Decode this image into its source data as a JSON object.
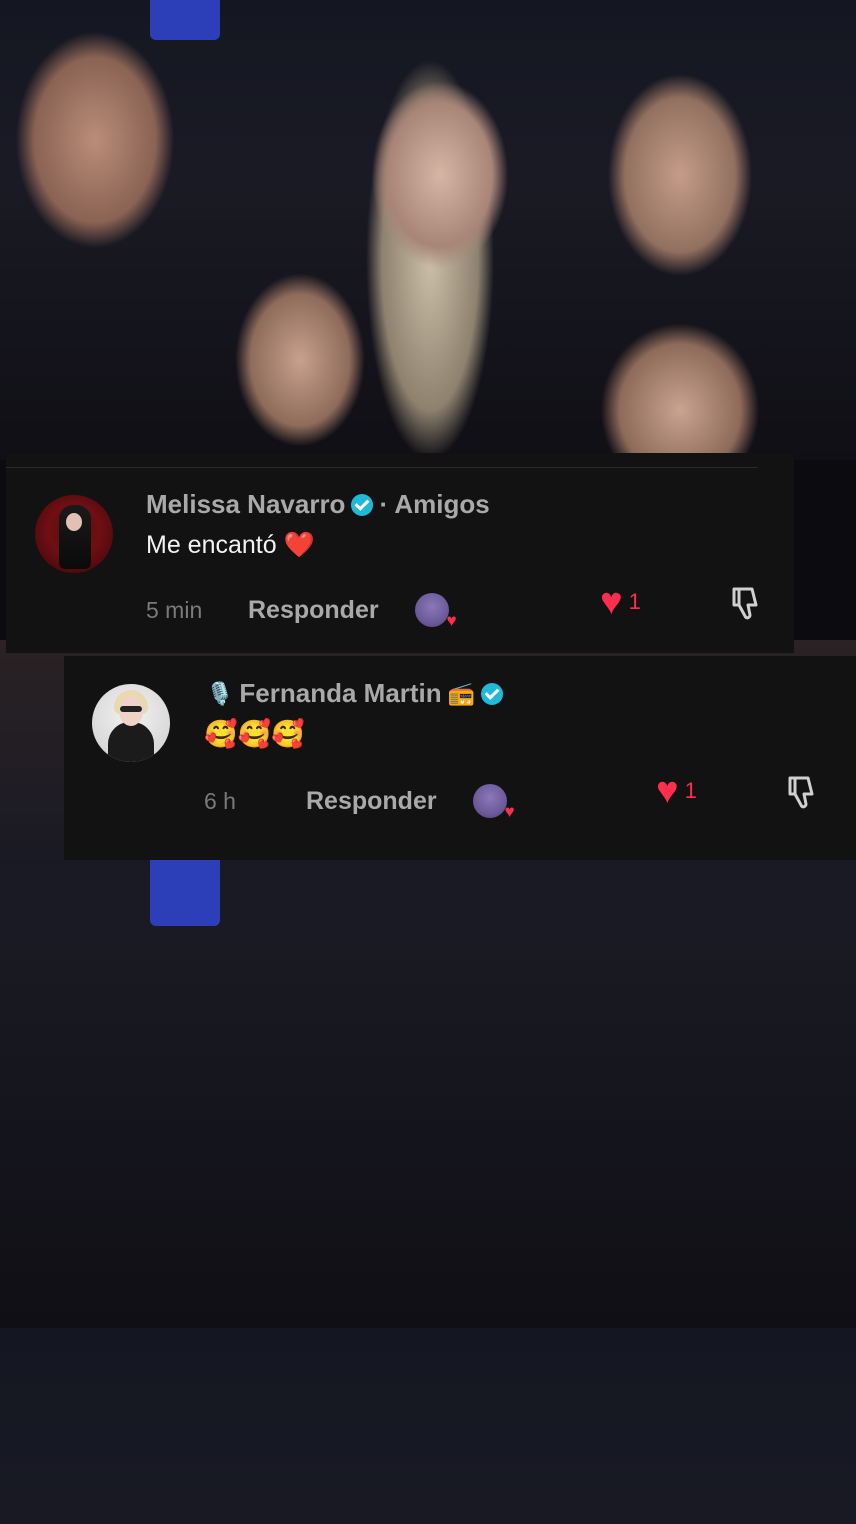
{
  "comments": [
    {
      "author": "Melissa Navarro",
      "suffix": "· Amigos",
      "text": "Me encantó",
      "text_emoji": "❤️",
      "time": "5 min",
      "reply_label": "Responder",
      "likes": "1"
    },
    {
      "author_prefix_icon": "🎙️",
      "author": "Fernanda Martin",
      "author_suffix_icon": "📻",
      "text": "🥰🥰🥰",
      "time": "6 h",
      "reply_label": "Responder",
      "likes": "1"
    }
  ],
  "colors": {
    "panel": "#121212",
    "name": "#a9a9a9",
    "verified": "#20b9d8",
    "like": "#ff2e4d"
  },
  "icons": [
    "verified-badge-icon",
    "heart-icon",
    "dislike-icon",
    "creator-liked-avatar-icon"
  ]
}
